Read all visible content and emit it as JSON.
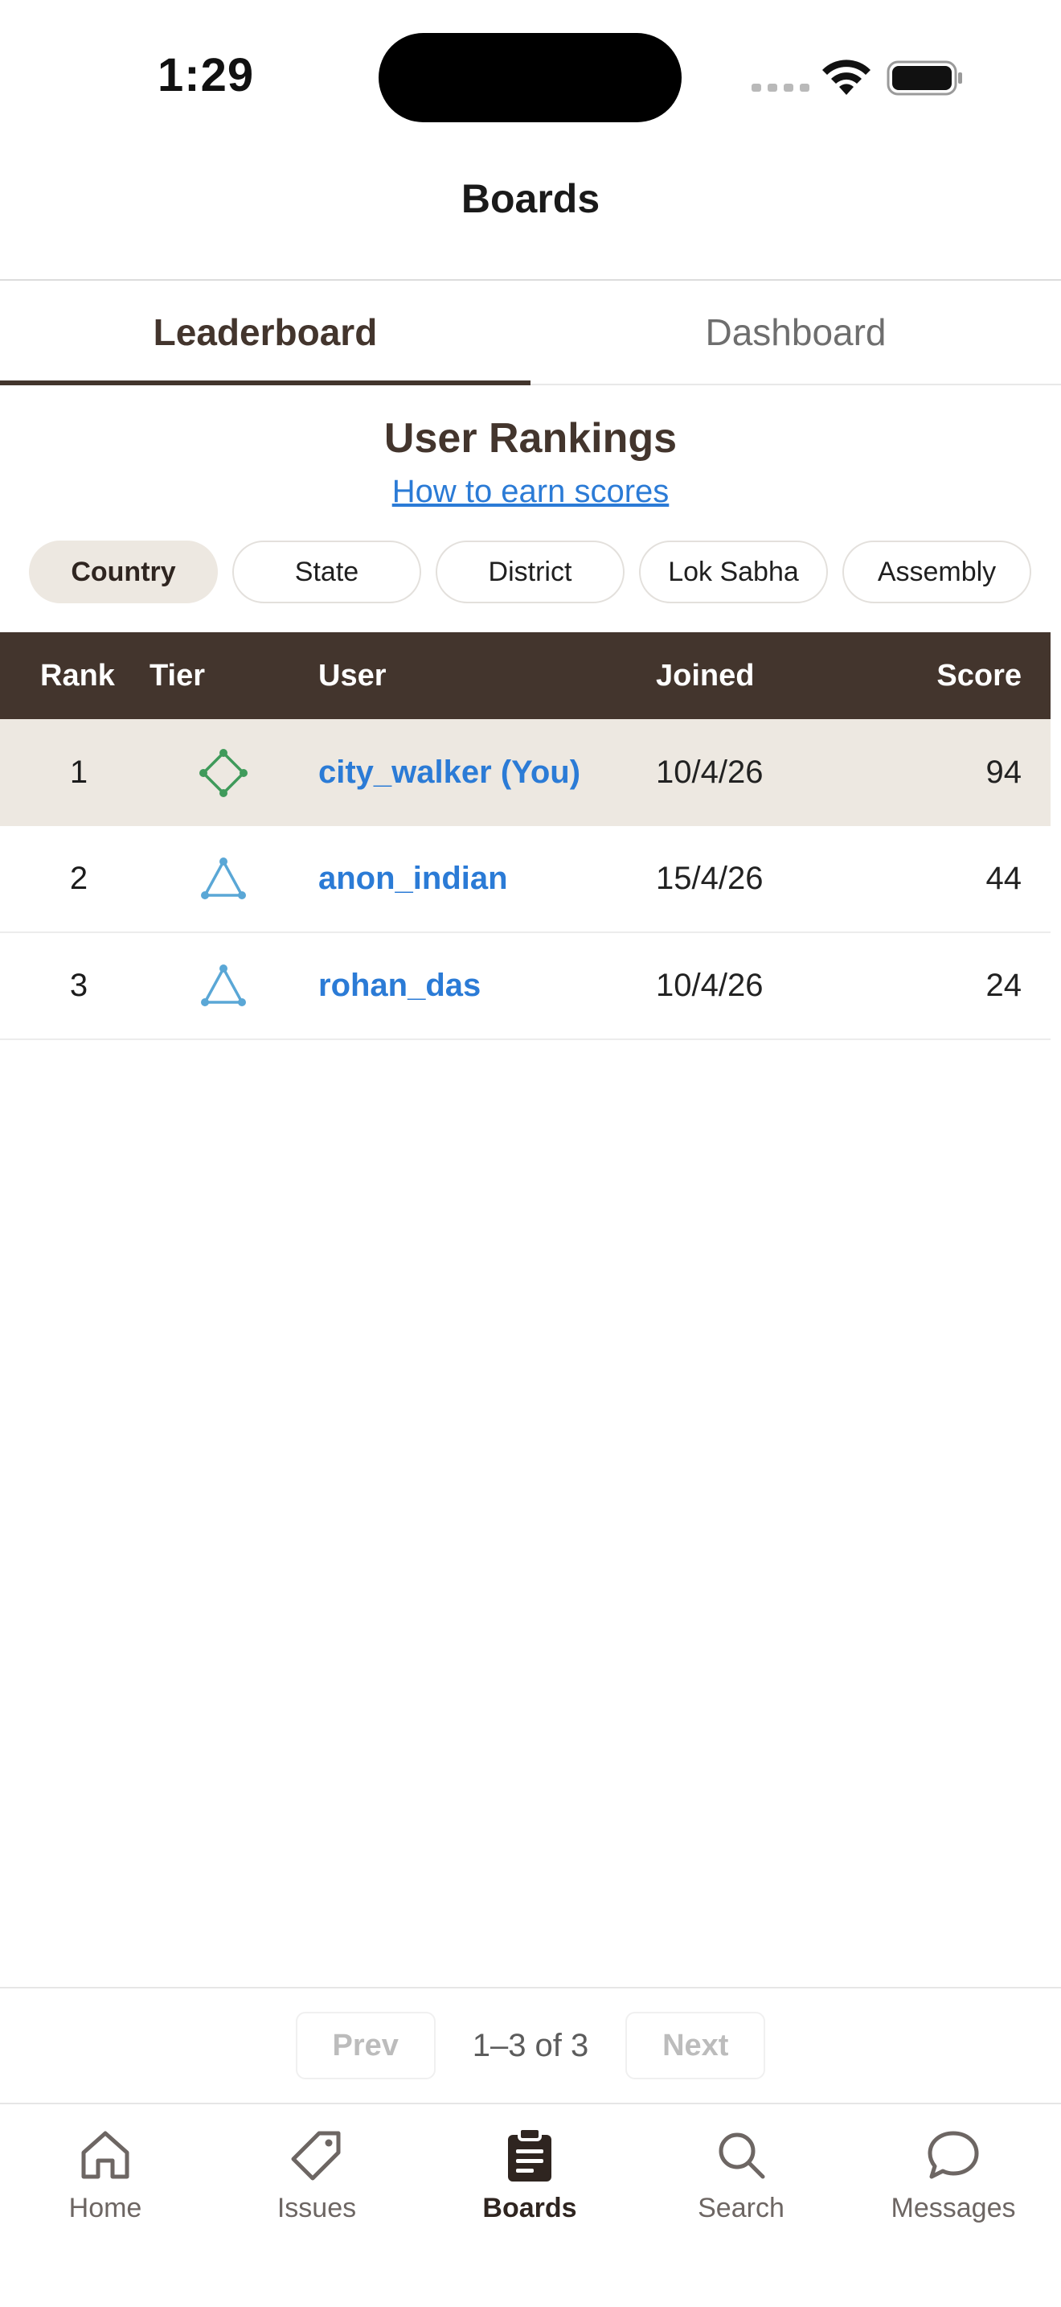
{
  "status_bar": {
    "time": "1:29"
  },
  "nav": {
    "title": "Boards"
  },
  "tabs": [
    {
      "label": "Leaderboard",
      "active": true
    },
    {
      "label": "Dashboard",
      "active": false
    }
  ],
  "heading": {
    "title": "User Rankings",
    "link": "How to earn scores"
  },
  "filters": [
    {
      "label": "Country",
      "active": true
    },
    {
      "label": "State"
    },
    {
      "label": "District"
    },
    {
      "label": "Lok Sabha"
    },
    {
      "label": "Assembly"
    }
  ],
  "table": {
    "headers": {
      "rank": "Rank",
      "tier": "Tier",
      "user": "User",
      "joined": "Joined",
      "score": "Score"
    },
    "rows": [
      {
        "rank": "1",
        "tier_icon": "diamond-tier-icon",
        "user": "city_walker (You)",
        "joined": "10/4/26",
        "score": "94"
      },
      {
        "rank": "2",
        "tier_icon": "triangle-tier-icon",
        "user": "anon_indian",
        "joined": "15/4/26",
        "score": "44"
      },
      {
        "rank": "3",
        "tier_icon": "triangle-tier-icon",
        "user": "rohan_das",
        "joined": "10/4/26",
        "score": "24"
      }
    ]
  },
  "pagination": {
    "prev": "Prev",
    "info": "1–3 of 3",
    "next": "Next"
  },
  "tabbar": [
    {
      "label": "Home",
      "icon": "home-icon"
    },
    {
      "label": "Issues",
      "icon": "tag-icon"
    },
    {
      "label": "Boards",
      "icon": "clipboard-icon",
      "active": true
    },
    {
      "label": "Search",
      "icon": "search-icon"
    },
    {
      "label": "Messages",
      "icon": "chat-bubble-icon"
    }
  ],
  "colors": {
    "brand_dark": "#43352d",
    "chip_active_bg": "#ede8e1",
    "link_blue": "#2b7bd6",
    "tier_green": "#3f9a5a",
    "tier_blue": "#5aa7d6"
  }
}
